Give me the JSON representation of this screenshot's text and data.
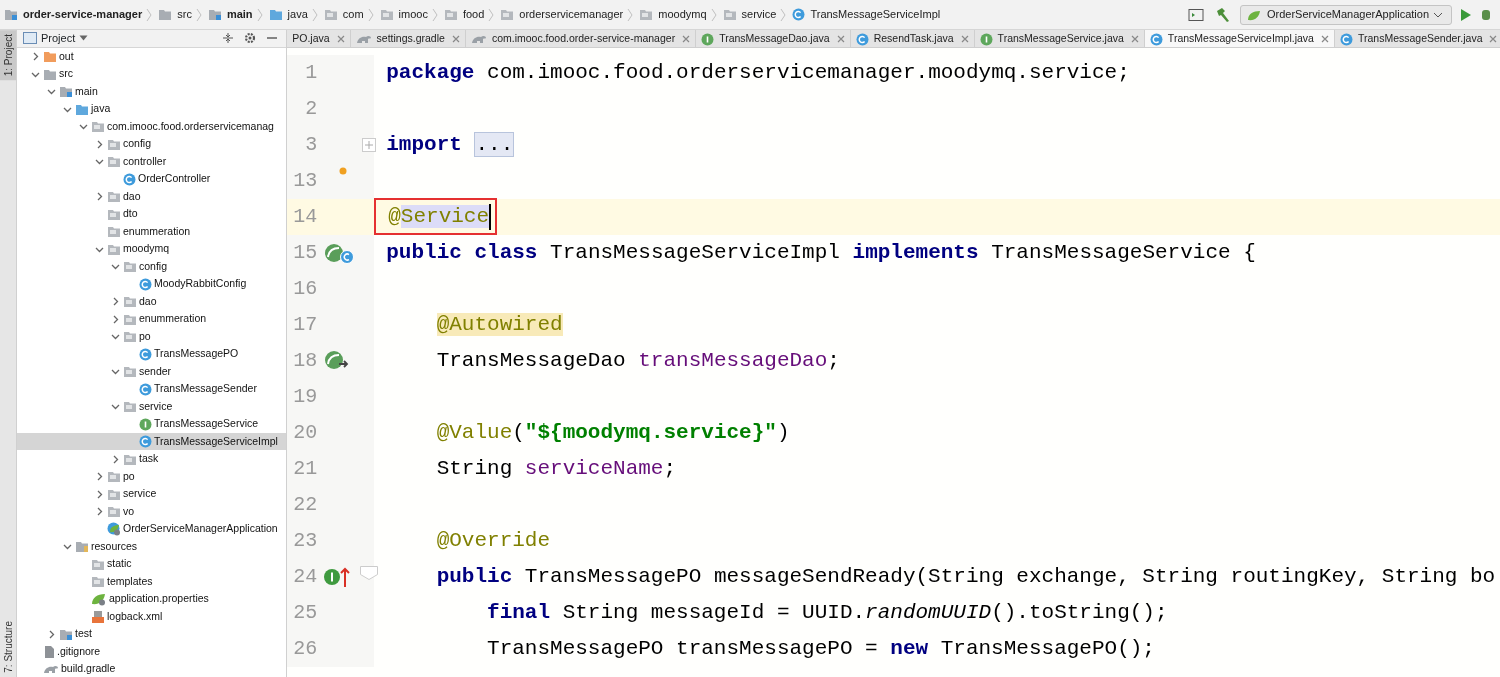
{
  "breadcrumbs": [
    {
      "label": "order-service-manager",
      "kind": "module",
      "bold": true
    },
    {
      "label": "src",
      "kind": "folder",
      "bold": false
    },
    {
      "label": "main",
      "kind": "module",
      "bold": true
    },
    {
      "label": "java",
      "kind": "source",
      "bold": false
    },
    {
      "label": "com",
      "kind": "package",
      "bold": false
    },
    {
      "label": "imooc",
      "kind": "package",
      "bold": false
    },
    {
      "label": "food",
      "kind": "package",
      "bold": false
    },
    {
      "label": "orderservicemanager",
      "kind": "package",
      "bold": false
    },
    {
      "label": "moodymq",
      "kind": "package",
      "bold": false
    },
    {
      "label": "service",
      "kind": "package",
      "bold": false
    },
    {
      "label": "TransMessageServiceImpl",
      "kind": "class",
      "bold": false
    }
  ],
  "run_config": {
    "label": "OrderServiceManagerApplication"
  },
  "tool_strip": [
    {
      "label": "1: Project",
      "selected": true
    },
    {
      "label": "7: Structure",
      "selected": false
    }
  ],
  "project_panel": {
    "title": "Project",
    "tree": [
      {
        "label": "out",
        "kind": "excluded",
        "expanded": false,
        "selected": false
      },
      {
        "label": "src",
        "kind": "folder",
        "expanded": true,
        "selected": false,
        "children": [
          {
            "label": "main",
            "kind": "module",
            "expanded": true,
            "selected": false,
            "children": [
              {
                "label": "java",
                "kind": "source",
                "expanded": true,
                "selected": false,
                "children": [
                  {
                    "label": "com.imooc.food.orderservicemanag",
                    "kind": "package",
                    "expanded": true,
                    "selected": false,
                    "children": [
                      {
                        "label": "config",
                        "kind": "package",
                        "expanded": false,
                        "selected": false
                      },
                      {
                        "label": "controller",
                        "kind": "package",
                        "expanded": true,
                        "selected": false,
                        "children": [
                          {
                            "label": "OrderController",
                            "kind": "class",
                            "selected": false
                          }
                        ]
                      },
                      {
                        "label": "dao",
                        "kind": "package",
                        "expanded": false,
                        "selected": false
                      },
                      {
                        "label": "dto",
                        "kind": "package",
                        "selected": false
                      },
                      {
                        "label": "enummeration",
                        "kind": "package",
                        "selected": false
                      },
                      {
                        "label": "moodymq",
                        "kind": "package",
                        "expanded": true,
                        "selected": false,
                        "children": [
                          {
                            "label": "config",
                            "kind": "package",
                            "expanded": true,
                            "selected": false,
                            "children": [
                              {
                                "label": "MoodyRabbitConfig",
                                "kind": "class",
                                "selected": false
                              }
                            ]
                          },
                          {
                            "label": "dao",
                            "kind": "package",
                            "expanded": false,
                            "selected": false
                          },
                          {
                            "label": "enummeration",
                            "kind": "package",
                            "expanded": false,
                            "selected": false
                          },
                          {
                            "label": "po",
                            "kind": "package",
                            "expanded": true,
                            "selected": false,
                            "children": [
                              {
                                "label": "TransMessagePO",
                                "kind": "class",
                                "selected": false
                              }
                            ]
                          },
                          {
                            "label": "sender",
                            "kind": "package",
                            "expanded": true,
                            "selected": false,
                            "children": [
                              {
                                "label": "TransMessageSender",
                                "kind": "class",
                                "selected": false
                              }
                            ]
                          },
                          {
                            "label": "service",
                            "kind": "package",
                            "expanded": true,
                            "selected": false,
                            "children": [
                              {
                                "label": "TransMessageService",
                                "kind": "interface",
                                "selected": false
                              },
                              {
                                "label": "TransMessageServiceImpl",
                                "kind": "class",
                                "selected": true
                              }
                            ]
                          },
                          {
                            "label": "task",
                            "kind": "package",
                            "expanded": false,
                            "selected": false
                          }
                        ]
                      },
                      {
                        "label": "po",
                        "kind": "package",
                        "expanded": false,
                        "selected": false
                      },
                      {
                        "label": "service",
                        "kind": "package",
                        "expanded": false,
                        "selected": false
                      },
                      {
                        "label": "vo",
                        "kind": "package",
                        "expanded": false,
                        "selected": false
                      },
                      {
                        "label": "OrderServiceManagerApplication",
                        "kind": "app",
                        "selected": false
                      }
                    ]
                  }
                ]
              },
              {
                "label": "resources",
                "kind": "resources",
                "expanded": true,
                "selected": false,
                "children": [
                  {
                    "label": "static",
                    "kind": "package",
                    "selected": false
                  },
                  {
                    "label": "templates",
                    "kind": "package",
                    "selected": false
                  },
                  {
                    "label": "application.properties",
                    "kind": "properties",
                    "selected": false
                  },
                  {
                    "label": "logback.xml",
                    "kind": "xml",
                    "selected": false
                  }
                ]
              }
            ]
          },
          {
            "label": "test",
            "kind": "module",
            "expanded": false,
            "selected": false
          }
        ]
      },
      {
        "label": ".gitignore",
        "kind": "file",
        "selected": false
      },
      {
        "label": "build.gradle",
        "kind": "gradle",
        "selected": false
      }
    ]
  },
  "tabs": [
    {
      "label": "PO.java",
      "selected": false
    },
    {
      "label": "settings.gradle",
      "kind": "gradle",
      "selected": false
    },
    {
      "label": "com.imooc.food.order-service-manager",
      "kind": "gradle",
      "selected": false
    },
    {
      "label": "TransMessageDao.java",
      "kind": "interface",
      "selected": false
    },
    {
      "label": "ResendTask.java",
      "kind": "class",
      "selected": false
    },
    {
      "label": "TransMessageService.java",
      "kind": "interface",
      "selected": false
    },
    {
      "label": "TransMessageServiceImpl.java",
      "kind": "class",
      "selected": true
    },
    {
      "label": "TransMessageSender.java",
      "kind": "class",
      "selected": false
    }
  ],
  "editor": {
    "lines": [
      {
        "number": "1",
        "tokens": [
          {
            "kind": "keyword",
            "text": "package"
          },
          {
            "kind": "plain",
            "text": " com.imooc.food.orderservicemanager.moodymq.service;"
          }
        ]
      },
      {
        "number": "2"
      },
      {
        "number": "3",
        "fold": {
          "expanded": false
        },
        "tokens": [
          {
            "kind": "keyword",
            "text": "import"
          },
          {
            "kind": "folded",
            "text": "..."
          }
        ]
      },
      {
        "number": "13",
        "bulb": true
      },
      {
        "number": "14",
        "current": true,
        "boxed": true,
        "caret": true,
        "tokens": [
          {
            "kind": "annotation",
            "text": "@"
          },
          {
            "kind": "annotation-selected",
            "text": "Service"
          }
        ]
      },
      {
        "number": "15",
        "gutter_icon": {
          "kind": "bean-class"
        },
        "tokens": [
          {
            "kind": "keyword",
            "text": "public class"
          },
          {
            "kind": "plain",
            "text": " TransMessageServiceImpl "
          },
          {
            "kind": "keyword",
            "text": "implements"
          },
          {
            "kind": "plain",
            "text": " TransMessageService {"
          }
        ],
        "children": [
          {
            "number": "16"
          },
          {
            "number": "17",
            "tokens": [
              {
                "kind": "annotation-marked",
                "text": "@Autowired"
              }
            ]
          },
          {
            "number": "18",
            "gutter_icon": {
              "kind": "bean"
            },
            "tokens": [
              {
                "kind": "plain",
                "text": "TransMessageDao "
              },
              {
                "kind": "field",
                "text": "transMessageDao"
              },
              {
                "kind": "plain",
                "text": ";"
              }
            ]
          },
          {
            "number": "19"
          },
          {
            "number": "20",
            "tokens": [
              {
                "kind": "annotation",
                "text": "@Value"
              },
              {
                "kind": "plain",
                "text": "("
              },
              {
                "kind": "string",
                "text": "\"${moodymq.service}\""
              },
              {
                "kind": "plain",
                "text": ")"
              }
            ]
          },
          {
            "number": "21",
            "tokens": [
              {
                "kind": "plain",
                "text": "String "
              },
              {
                "kind": "field",
                "text": "serviceName"
              },
              {
                "kind": "plain",
                "text": ";"
              }
            ]
          },
          {
            "number": "22"
          },
          {
            "number": "23",
            "tokens": [
              {
                "kind": "annotation",
                "text": "@Override"
              }
            ]
          },
          {
            "number": "24",
            "gutter_icon": {
              "kind": "implements"
            },
            "fold": {
              "expanded": true
            },
            "tokens": [
              {
                "kind": "keyword",
                "text": "public"
              },
              {
                "kind": "plain",
                "text": " TransMessagePO messageSendReady(String exchange, String routingKey, String bo"
              }
            ],
            "children": [
              {
                "number": "25",
                "tokens": [
                  {
                    "kind": "keyword",
                    "text": "final"
                  },
                  {
                    "kind": "plain",
                    "text": " String messageId = UUID."
                  },
                  {
                    "kind": "italic",
                    "text": "randomUUID"
                  },
                  {
                    "kind": "plain",
                    "text": "().toString();"
                  }
                ]
              },
              {
                "number": "26",
                "tokens": [
                  {
                    "kind": "plain",
                    "text": "TransMessagePO transMessagePO = "
                  },
                  {
                    "kind": "keyword",
                    "text": "new"
                  },
                  {
                    "kind": "plain",
                    "text": " TransMessagePO();"
                  }
                ]
              }
            ]
          }
        ]
      }
    ]
  }
}
